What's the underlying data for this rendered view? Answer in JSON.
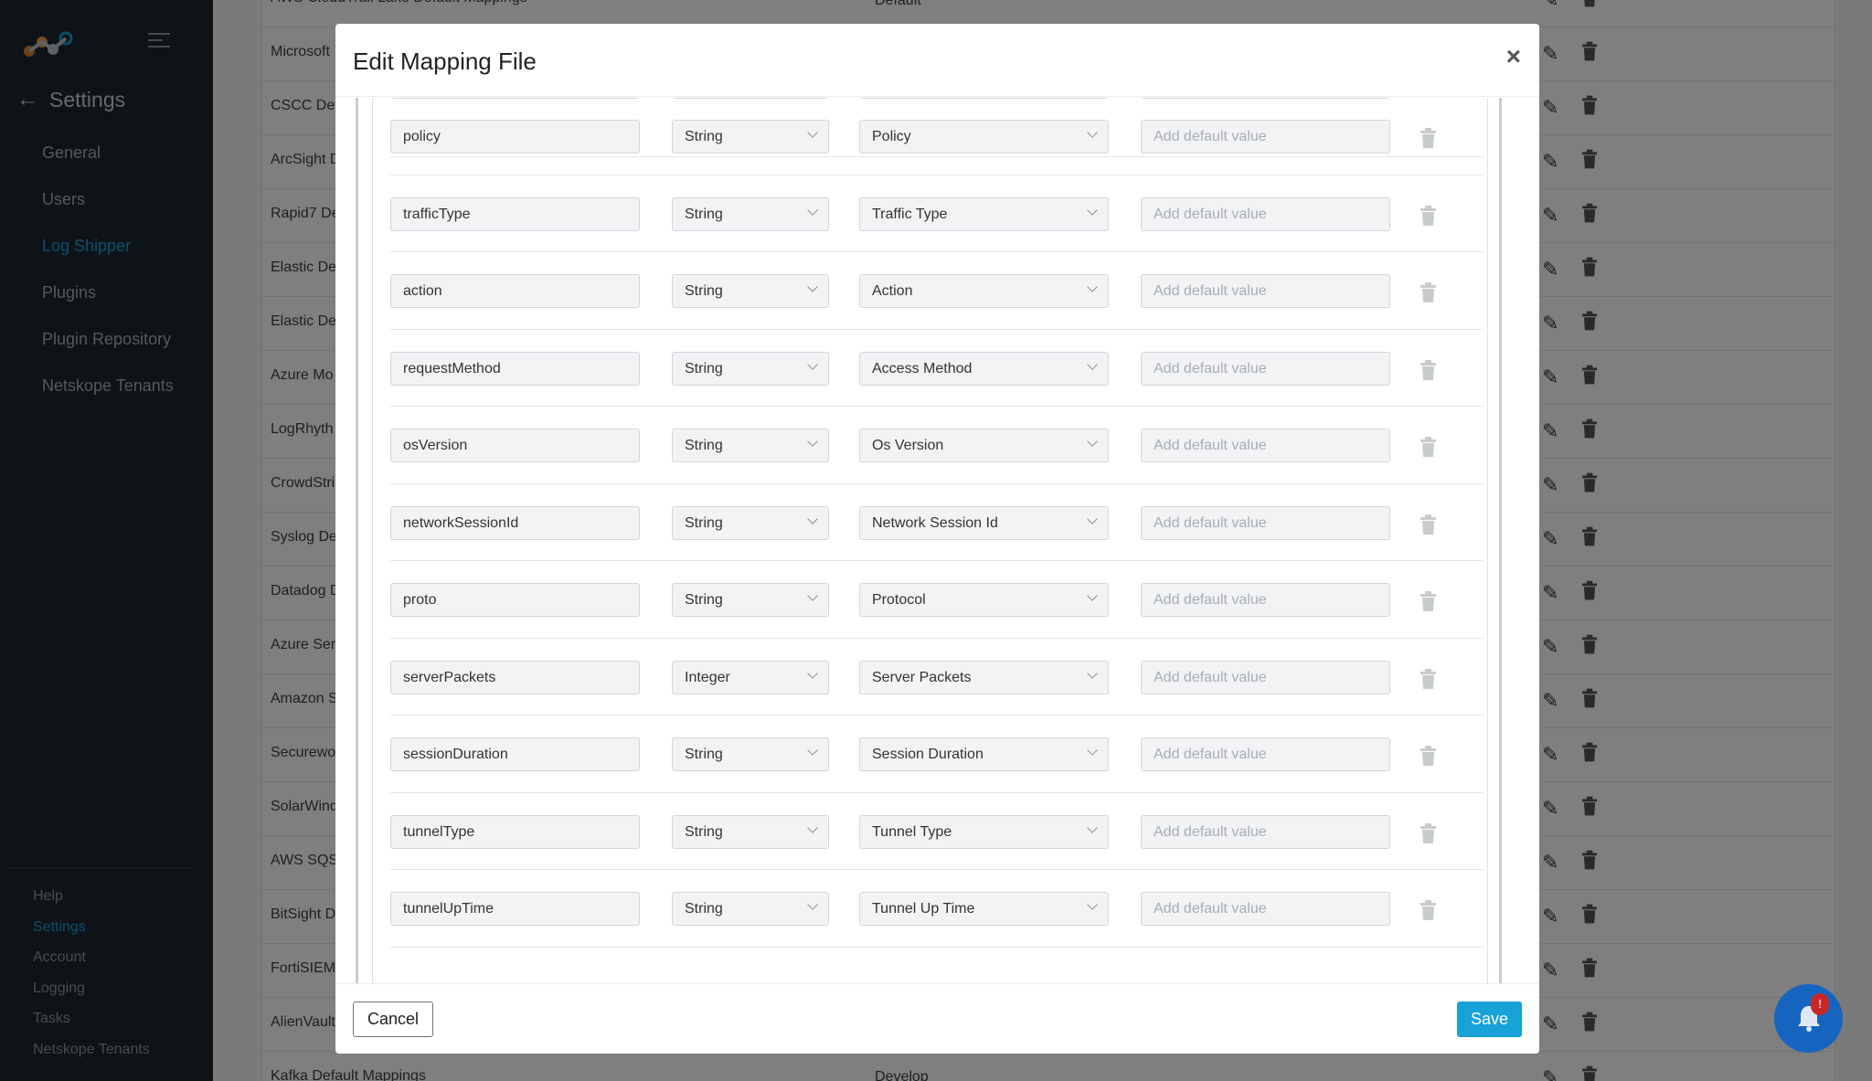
{
  "sidebar": {
    "back_label": "Settings",
    "nav": [
      "General",
      "Users",
      "Log Shipper",
      "Plugins",
      "Plugin Repository",
      "Netskope Tenants"
    ],
    "active_nav": "Log Shipper",
    "footer": [
      "Help",
      "Settings",
      "Account",
      "Logging",
      "Tasks",
      "Netskope Tenants"
    ],
    "active_footer": "Settings"
  },
  "background_rows": [
    "AWS CloudTrail Lake Default Mappings",
    "Microsoft",
    "CSCC Def",
    "ArcSight D",
    "Rapid7 De",
    "Elastic De",
    "Elastic De",
    "Azure Mo",
    "LogRhyth",
    "CrowdStri",
    "Syslog De",
    "Datadog D",
    "Azure Ser",
    "Amazon S",
    "Securewo",
    "SolarWind",
    "AWS SQS",
    "BitSight D",
    "FortiSIEM",
    "AlienVault",
    "Kafka Default Mappings"
  ],
  "background_partial": {
    "top_right": "Default",
    "bottom_right": "Develop"
  },
  "modal": {
    "title": "Edit Mapping File",
    "close_glyph": "×",
    "default_placeholder": "Add default value",
    "rows": [
      {
        "name": "policy",
        "type": "String",
        "mapped": "Policy"
      },
      {
        "name": "trafficType",
        "type": "String",
        "mapped": "Traffic Type"
      },
      {
        "name": "action",
        "type": "String",
        "mapped": "Action"
      },
      {
        "name": "requestMethod",
        "type": "String",
        "mapped": "Access Method"
      },
      {
        "name": "osVersion",
        "type": "String",
        "mapped": "Os Version"
      },
      {
        "name": "networkSessionId",
        "type": "String",
        "mapped": "Network Session Id"
      },
      {
        "name": "proto",
        "type": "String",
        "mapped": "Protocol"
      },
      {
        "name": "serverPackets",
        "type": "Integer",
        "mapped": "Server Packets"
      },
      {
        "name": "sessionDuration",
        "type": "String",
        "mapped": "Session Duration"
      },
      {
        "name": "tunnelType",
        "type": "String",
        "mapped": "Tunnel Type"
      },
      {
        "name": "tunnelUpTime",
        "type": "String",
        "mapped": "Tunnel Up Time"
      }
    ],
    "cancel_label": "Cancel",
    "save_label": "Save"
  },
  "notification": {
    "badge": "!"
  },
  "colors": {
    "accent": "#17a2d8",
    "sidebar": "#1d2630",
    "bell": "#1565c0",
    "badge": "#c62828"
  }
}
